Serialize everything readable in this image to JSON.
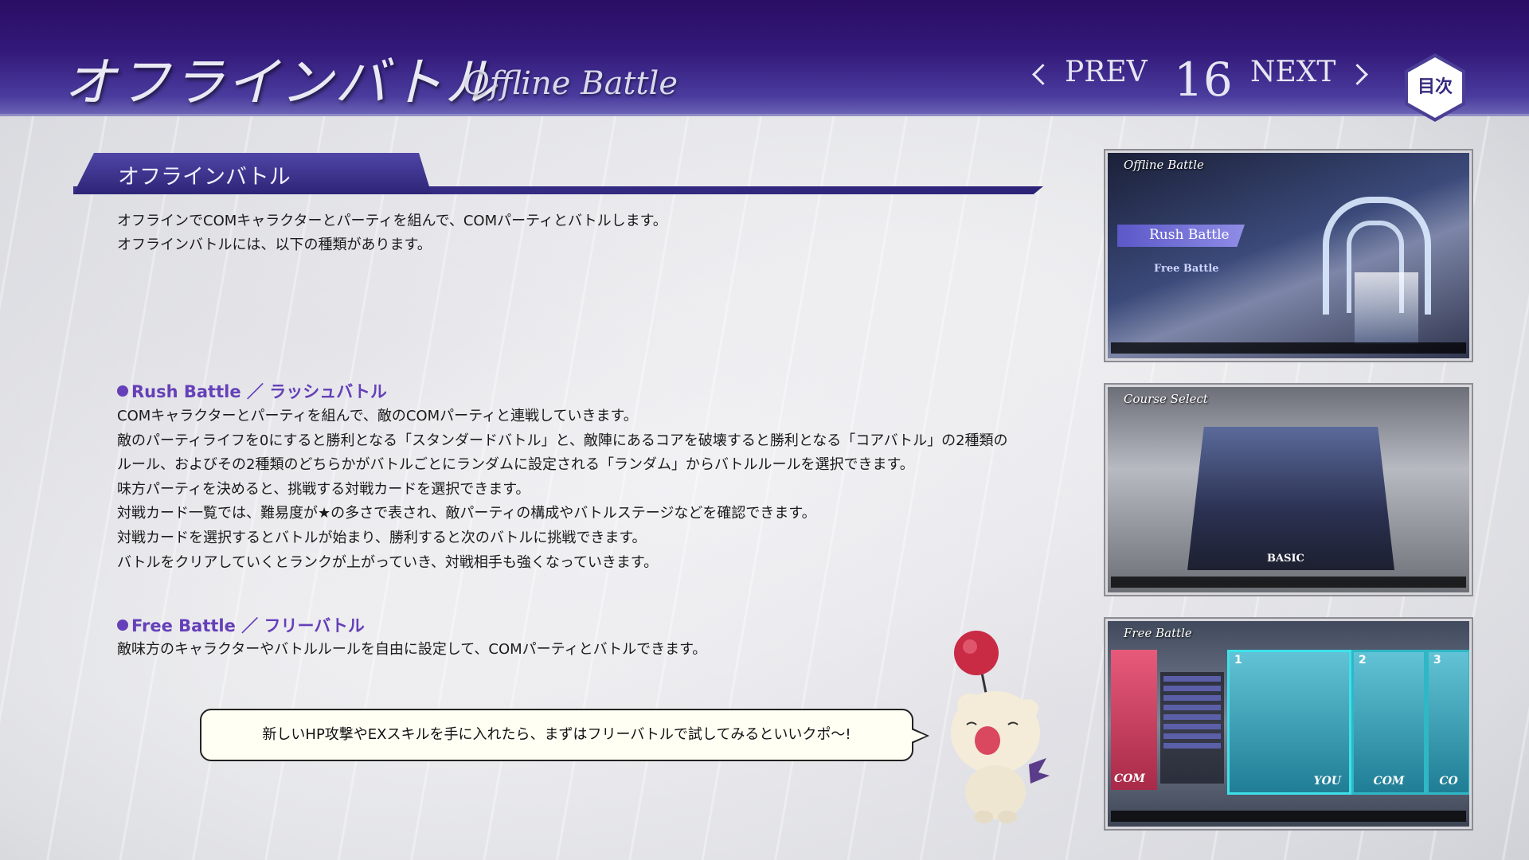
{
  "header": {
    "title_jp": "オフラインバトル",
    "title_en": "Offline Battle",
    "prev_label": "PREV",
    "page_number": "16",
    "next_label": "NEXT",
    "toc_label": "目次"
  },
  "section": {
    "title": "オフラインバトル",
    "intro": [
      "オフラインでCOMキャラクターとパーティを組んで、COMパーティとバトルします。",
      "オフラインバトルには、以下の種類があります。"
    ]
  },
  "rush": {
    "heading": "Rush Battle ／ ラッシュバトル",
    "lines": [
      "COMキャラクターとパーティを組んで、敵のCOMパーティと連戦していきます。",
      "敵のパーティライフを0にすると勝利となる「スタンダードバトル」と、敵陣にあるコアを破壊すると勝利となる「コアバトル」の2種類の",
      "ルール、およびその2種類のどちらかがバトルごとにランダムに設定される「ランダム」からバトルルールを選択できます。",
      "味方パーティを決めると、挑戦する対戦カードを選択できます。",
      "対戦カード一覧では、難易度が★の多さで表され、敵パーティの構成やバトルステージなどを確認できます。",
      "対戦カードを選択するとバトルが始まり、勝利すると次のバトルに挑戦できます。",
      "バトルをクリアしていくとランクが上がっていき、対戦相手も強くなっていきます。"
    ]
  },
  "free": {
    "heading": "Free Battle ／ フリーバトル",
    "lines": [
      "敵味方のキャラクターやバトルルールを自由に設定して、COMパーティとバトルできます。"
    ]
  },
  "bubble": {
    "text": "新しいHP攻撃やEXスキルを手に入れたら、まずはフリーバトルで試してみるといいクポ～!"
  },
  "screens": [
    {
      "caption": "Offline Battle",
      "menu_selected": "Rush Battle",
      "menu_other": "Free Battle"
    },
    {
      "caption": "Course Select",
      "label": "BASIC"
    },
    {
      "caption": "Free Battle",
      "cards": [
        "1",
        "2",
        "3"
      ],
      "card_labels": [
        "COM",
        "YOU",
        "COM",
        "CO"
      ]
    }
  ],
  "colors": {
    "accent": "#6540b8",
    "header": "#2a0d63"
  }
}
